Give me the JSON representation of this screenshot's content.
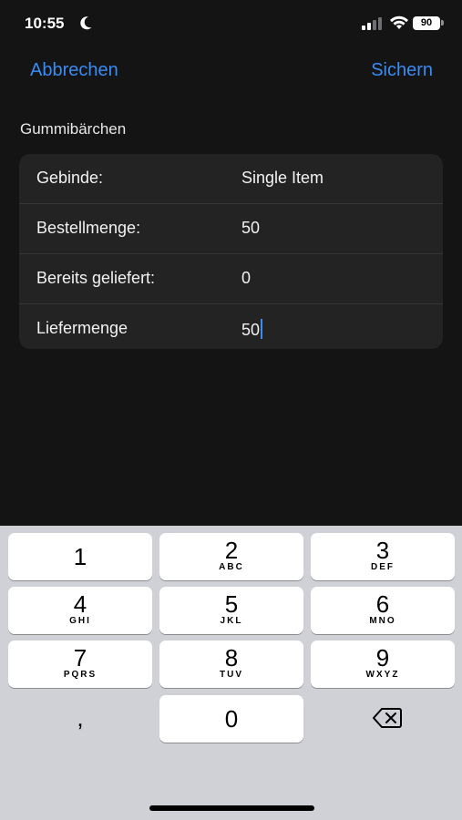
{
  "status": {
    "time": "10:55",
    "battery": "90"
  },
  "nav": {
    "cancel": "Abbrechen",
    "save": "Sichern"
  },
  "section": {
    "title": "Gummibärchen"
  },
  "rows": [
    {
      "label": "Gebinde:",
      "value": "Single Item"
    },
    {
      "label": "Bestellmenge:",
      "value": "50"
    },
    {
      "label": "Bereits geliefert:",
      "value": "0"
    },
    {
      "label": "Liefermenge",
      "value": "50"
    }
  ],
  "keyboard": {
    "keys": [
      {
        "digit": "1",
        "letters": ""
      },
      {
        "digit": "2",
        "letters": "ABC"
      },
      {
        "digit": "3",
        "letters": "DEF"
      },
      {
        "digit": "4",
        "letters": "GHI"
      },
      {
        "digit": "5",
        "letters": "JKL"
      },
      {
        "digit": "6",
        "letters": "MNO"
      },
      {
        "digit": "7",
        "letters": "PQRS"
      },
      {
        "digit": "8",
        "letters": "TUV"
      },
      {
        "digit": "9",
        "letters": "WXYZ"
      },
      {
        "digit": "0",
        "letters": ""
      }
    ],
    "comma": ",",
    "delete_icon": "backspace-icon"
  },
  "colors": {
    "accent": "#3a8bf5",
    "background": "#141414",
    "card": "#232323",
    "keyboard": "#cfd1d6"
  }
}
